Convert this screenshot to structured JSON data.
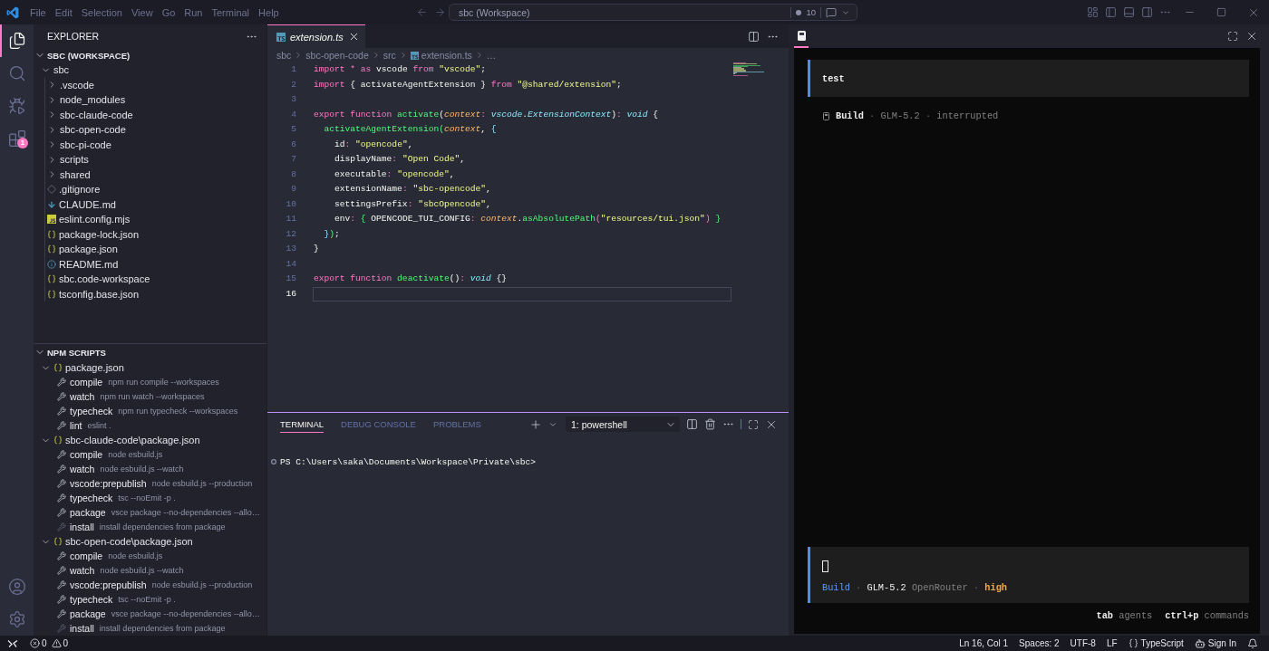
{
  "title_bar": {
    "menu": [
      "File",
      "Edit",
      "Selection",
      "View",
      "Go",
      "Run",
      "Terminal",
      "Help"
    ],
    "command_center": "sbc (Workspace)",
    "count": "10"
  },
  "activity_bar": {
    "items": [
      {
        "kind": "explorer",
        "selected": true
      },
      {
        "kind": "search",
        "selected": false
      },
      {
        "kind": "run_debug",
        "selected": false
      },
      {
        "kind": "extensions",
        "selected": false,
        "badge": "1"
      }
    ],
    "bottom": [
      {
        "kind": "account"
      },
      {
        "kind": "settings"
      }
    ]
  },
  "explorer": {
    "title": "EXPLORER",
    "root": {
      "label": "SBC (WORKSPACE)",
      "expanded": true,
      "children": [
        {
          "label": "sbc",
          "kind": "folder",
          "expanded": true,
          "children": [
            {
              "label": ".vscode",
              "kind": "folder",
              "expanded": false
            },
            {
              "label": "node_modules",
              "kind": "folder",
              "expanded": false
            },
            {
              "label": "sbc-claude-code",
              "kind": "folder",
              "expanded": false
            },
            {
              "label": "sbc-open-code",
              "kind": "folder",
              "expanded": false
            },
            {
              "label": "sbc-pi-code",
              "kind": "folder",
              "expanded": false
            },
            {
              "label": "scripts",
              "kind": "folder",
              "expanded": false
            },
            {
              "label": "shared",
              "kind": "folder",
              "expanded": false
            },
            {
              "label": ".gitignore",
              "kind": "gitignore"
            },
            {
              "label": "CLAUDE.md",
              "kind": "markdown"
            },
            {
              "label": "eslint.config.mjs",
              "kind": "javascript"
            },
            {
              "label": "package-lock.json",
              "kind": "json"
            },
            {
              "label": "package.json",
              "kind": "json"
            },
            {
              "label": "README.md",
              "kind": "info"
            },
            {
              "label": "sbc.code-workspace",
              "kind": "json"
            },
            {
              "label": "tsconfig.base.json",
              "kind": "json"
            }
          ]
        }
      ]
    }
  },
  "npm_scripts": {
    "title": "NPM SCRIPTS",
    "expanded": true,
    "packages": [
      {
        "label": "package.json",
        "expanded": true,
        "scripts": [
          {
            "name": "compile",
            "command": "npm run compile --workspaces",
            "kind": "script"
          },
          {
            "name": "watch",
            "command": "npm run watch --workspaces",
            "kind": "script"
          },
          {
            "name": "typecheck",
            "command": "npm run typecheck --workspaces",
            "kind": "script"
          },
          {
            "name": "lint",
            "command": "eslint .",
            "kind": "script"
          }
        ]
      },
      {
        "label": "sbc-claude-code\\package.json",
        "expanded": true,
        "scripts": [
          {
            "name": "compile",
            "command": "node esbuild.js",
            "kind": "script"
          },
          {
            "name": "watch",
            "command": "node esbuild.js --watch",
            "kind": "script"
          },
          {
            "name": "vscode:prepublish",
            "command": "node esbuild.js --production",
            "kind": "script"
          },
          {
            "name": "typecheck",
            "command": "tsc --noEmit -p .",
            "kind": "script"
          },
          {
            "name": "package",
            "command": "vsce package --no-dependencies --allo…",
            "kind": "script"
          },
          {
            "name": "install",
            "command": "install dependencies from package",
            "kind": "install"
          }
        ]
      },
      {
        "label": "sbc-open-code\\package.json",
        "expanded": true,
        "scripts": [
          {
            "name": "compile",
            "command": "node esbuild.js",
            "kind": "script"
          },
          {
            "name": "watch",
            "command": "node esbuild.js --watch",
            "kind": "script"
          },
          {
            "name": "vscode:prepublish",
            "command": "node esbuild.js --production",
            "kind": "script"
          },
          {
            "name": "typecheck",
            "command": "tsc --noEmit -p .",
            "kind": "script"
          },
          {
            "name": "package",
            "command": "vsce package --no-dependencies --allo…",
            "kind": "script"
          },
          {
            "name": "install",
            "command": "install dependencies from package",
            "kind": "install"
          }
        ]
      }
    ]
  },
  "editor": {
    "tabs": [
      {
        "label": "extension.ts",
        "selected": true,
        "preview": true
      }
    ],
    "breadcrumbs": [
      {
        "label": "sbc",
        "kind": "text"
      },
      {
        "label": "sbc-open-code",
        "kind": "text"
      },
      {
        "label": "src",
        "kind": "text"
      },
      {
        "label": "extension.ts",
        "kind": "typescript"
      },
      {
        "label": "…",
        "kind": "text"
      }
    ],
    "lines": [
      {
        "number": "1",
        "current": false,
        "tokens": [
          {
            "kind": "keyword",
            "text": "import * as"
          },
          {
            "kind": "plain",
            "text": " vscode "
          },
          {
            "kind": "keyword",
            "text": "from"
          },
          {
            "kind": "string",
            "text": " \"vscode\""
          },
          {
            "kind": "plain",
            "text": ";"
          }
        ]
      },
      {
        "number": "2",
        "current": false,
        "tokens": [
          {
            "kind": "keyword",
            "text": "import"
          },
          {
            "kind": "plain",
            "text": " { activateAgentExtension } "
          },
          {
            "kind": "keyword",
            "text": "from"
          },
          {
            "kind": "string",
            "text": " \"@shared/extension\""
          },
          {
            "kind": "plain",
            "text": ";"
          }
        ]
      },
      {
        "number": "3",
        "current": false
      },
      {
        "number": "4",
        "current": false,
        "tokens": [
          {
            "kind": "keyword",
            "text": "export function"
          },
          {
            "kind": "function",
            "text": " activate"
          },
          {
            "kind": "plain",
            "text": "("
          },
          {
            "kind": "parameter",
            "text": "context"
          },
          {
            "kind": "operator",
            "text": ":"
          },
          {
            "kind": "type",
            "text": " vscode"
          },
          {
            "kind": "plain",
            "text": "."
          },
          {
            "kind": "type",
            "text": "ExtensionContext"
          },
          {
            "kind": "plain",
            "text": ")"
          },
          {
            "kind": "operator",
            "text": ":"
          },
          {
            "kind": "type",
            "text": " void"
          },
          {
            "kind": "plain",
            "text": " {"
          }
        ]
      },
      {
        "number": "5",
        "current": false,
        "tokens": [
          {
            "kind": "function",
            "text": "  activateAgentExtension"
          },
          {
            "kind": "bracket2",
            "text": "("
          },
          {
            "kind": "parameter",
            "text": "context"
          },
          {
            "kind": "plain",
            "text": ", "
          },
          {
            "kind": "bracket3",
            "text": "{"
          }
        ]
      },
      {
        "number": "6",
        "current": false,
        "tokens": [
          {
            "kind": "plain",
            "text": "    id"
          },
          {
            "kind": "operator",
            "text": ":"
          },
          {
            "kind": "string",
            "text": " \"opencode\""
          },
          {
            "kind": "plain",
            "text": ","
          }
        ]
      },
      {
        "number": "7",
        "current": false,
        "tokens": [
          {
            "kind": "plain",
            "text": "    displayName"
          },
          {
            "kind": "operator",
            "text": ":"
          },
          {
            "kind": "string",
            "text": " \"Open Code\""
          },
          {
            "kind": "plain",
            "text": ","
          }
        ]
      },
      {
        "number": "8",
        "current": false,
        "tokens": [
          {
            "kind": "plain",
            "text": "    executable"
          },
          {
            "kind": "operator",
            "text": ":"
          },
          {
            "kind": "string",
            "text": " \"opencode\""
          },
          {
            "kind": "plain",
            "text": ","
          }
        ]
      },
      {
        "number": "9",
        "current": false,
        "tokens": [
          {
            "kind": "plain",
            "text": "    extensionName"
          },
          {
            "kind": "operator",
            "text": ":"
          },
          {
            "kind": "string",
            "text": " \"sbc-opencode\""
          },
          {
            "kind": "plain",
            "text": ","
          }
        ]
      },
      {
        "number": "10",
        "current": false,
        "tokens": [
          {
            "kind": "plain",
            "text": "    settingsPrefix"
          },
          {
            "kind": "operator",
            "text": ":"
          },
          {
            "kind": "string",
            "text": " \"sbcOpencode\""
          },
          {
            "kind": "plain",
            "text": ","
          }
        ]
      },
      {
        "number": "11",
        "current": false,
        "tokens": [
          {
            "kind": "plain",
            "text": "    env"
          },
          {
            "kind": "operator",
            "text": ":"
          },
          {
            "kind": "bracket2",
            "text": " {"
          },
          {
            "kind": "plain",
            "text": " OPENCODE_TUI_CONFIG"
          },
          {
            "kind": "operator",
            "text": ":"
          },
          {
            "kind": "parameter",
            "text": " context"
          },
          {
            "kind": "plain",
            "text": "."
          },
          {
            "kind": "function",
            "text": "asAbsolutePath"
          },
          {
            "kind": "bracket4",
            "text": "("
          },
          {
            "kind": "string",
            "text": "\"resources/tui.json\""
          },
          {
            "kind": "bracket4",
            "text": ")"
          },
          {
            "kind": "bracket2",
            "text": " }"
          }
        ]
      },
      {
        "number": "12",
        "current": false,
        "tokens": [
          {
            "kind": "bracket3",
            "text": "  }"
          },
          {
            "kind": "bracket2",
            "text": ")"
          },
          {
            "kind": "plain",
            "text": ";"
          }
        ]
      },
      {
        "number": "13",
        "current": false,
        "tokens": [
          {
            "kind": "plain",
            "text": "}"
          }
        ]
      },
      {
        "number": "14",
        "current": false
      },
      {
        "number": "15",
        "current": false,
        "tokens": [
          {
            "kind": "keyword",
            "text": "export function"
          },
          {
            "kind": "function",
            "text": " deactivate"
          },
          {
            "kind": "plain",
            "text": "()"
          },
          {
            "kind": "operator",
            "text": ":"
          },
          {
            "kind": "type",
            "text": " void"
          },
          {
            "kind": "plain",
            "text": " {}"
          }
        ]
      },
      {
        "number": "16",
        "current": true
      }
    ]
  },
  "terminal": {
    "tabs": [
      {
        "label": "TERMINAL",
        "selected": true
      },
      {
        "label": "DEBUG CONSOLE",
        "selected": false
      },
      {
        "label": "PROBLEMS",
        "selected": false
      }
    ],
    "shell": "1: powershell",
    "lines": [
      "PS C:\\Users\\saka\\Documents\\Workspace\\Private\\sbc>"
    ]
  },
  "agent_panel": {
    "tabs": [
      {
        "selected": true
      }
    ],
    "messages": [
      {
        "kind": "user",
        "text": "test"
      },
      {
        "kind": "status",
        "parts": [
          {
            "kind": "strong",
            "text": "Build"
          },
          {
            "kind": "separator",
            "text": "·"
          },
          {
            "kind": "muted",
            "text": "GLM-5.2"
          },
          {
            "kind": "separator",
            "text": "·"
          },
          {
            "kind": "muted",
            "text": "interrupted"
          }
        ]
      }
    ],
    "prompt": {
      "parts": [
        {
          "kind": "accent",
          "text": "Build"
        },
        {
          "kind": "separator",
          "text": "·"
        },
        {
          "kind": "model",
          "text": "GLM-5.2"
        },
        {
          "kind": "muted",
          "text": "OpenRouter"
        },
        {
          "kind": "separator",
          "text": "·"
        },
        {
          "kind": "warning",
          "text": "high"
        }
      ]
    },
    "hints": [
      {
        "key": "tab",
        "label": "agents"
      },
      {
        "key": "ctrl+p",
        "label": "commands"
      }
    ]
  },
  "status_bar": {
    "problems": {
      "errors": "0",
      "warnings": "0"
    },
    "items": [
      {
        "kind": "text",
        "text": "Ln 16, Col 1"
      },
      {
        "kind": "text",
        "text": "Spaces: 2"
      },
      {
        "kind": "text",
        "text": "UTF-8"
      },
      {
        "kind": "text",
        "text": "LF"
      },
      {
        "kind": "language",
        "text": "TypeScript"
      },
      {
        "kind": "account",
        "text": "Sign In"
      },
      {
        "kind": "notifications"
      }
    ]
  }
}
